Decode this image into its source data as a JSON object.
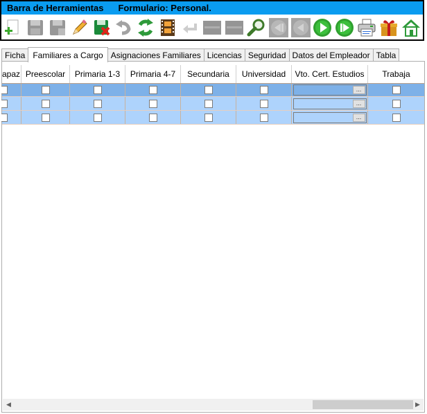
{
  "toolbar": {
    "title": "Barra de Herramientas",
    "form_label": "Formulario: Personal.",
    "icons": [
      {
        "name": "new-record-icon",
        "enabled": true
      },
      {
        "name": "save-icon",
        "enabled": false
      },
      {
        "name": "save-as-icon",
        "enabled": false
      },
      {
        "name": "edit-pencil-icon",
        "enabled": true
      },
      {
        "name": "delete-save-icon",
        "enabled": true
      },
      {
        "name": "undo-icon",
        "enabled": false
      },
      {
        "name": "refresh-icon",
        "enabled": true
      },
      {
        "name": "film-strip-icon",
        "enabled": true
      },
      {
        "name": "return-arrow-icon",
        "enabled": false
      },
      {
        "name": "insert-row-icon",
        "enabled": false
      },
      {
        "name": "delete-row-icon",
        "enabled": false
      },
      {
        "name": "search-icon",
        "enabled": true
      },
      {
        "name": "first-record-icon",
        "enabled": false
      },
      {
        "name": "previous-record-icon",
        "enabled": false
      },
      {
        "name": "next-record-icon",
        "enabled": true
      },
      {
        "name": "last-record-icon",
        "enabled": true
      },
      {
        "name": "printer-icon",
        "enabled": true
      },
      {
        "name": "gift-icon",
        "enabled": true
      },
      {
        "name": "home-icon",
        "enabled": true
      }
    ]
  },
  "tabs": [
    {
      "label": "Ficha",
      "active": false
    },
    {
      "label": "Familiares a Cargo",
      "active": true
    },
    {
      "label": "Asignaciones Familiares",
      "active": false
    },
    {
      "label": "Licencias",
      "active": false
    },
    {
      "label": "Seguridad",
      "active": false
    },
    {
      "label": "Datos del Empleador",
      "active": false
    },
    {
      "label": "Tabla",
      "active": false
    }
  ],
  "grid": {
    "columns": [
      "apaz",
      "Preescolar",
      "Primaria 1-3",
      "Primaria 4-7",
      "Secundaria",
      "Universidad",
      "Vto. Cert. Estudios",
      "Trabaja"
    ],
    "rows": [
      {
        "selected": true,
        "date_value": "",
        "date_button": "..."
      },
      {
        "selected": false,
        "date_value": "",
        "date_button": "..."
      },
      {
        "selected": false,
        "date_value": "",
        "date_button": "..."
      }
    ]
  },
  "colors": {
    "title_bar": "#0a9cf0",
    "row_selected": "#7eb1e8",
    "row_normal": "#aed3fc"
  }
}
